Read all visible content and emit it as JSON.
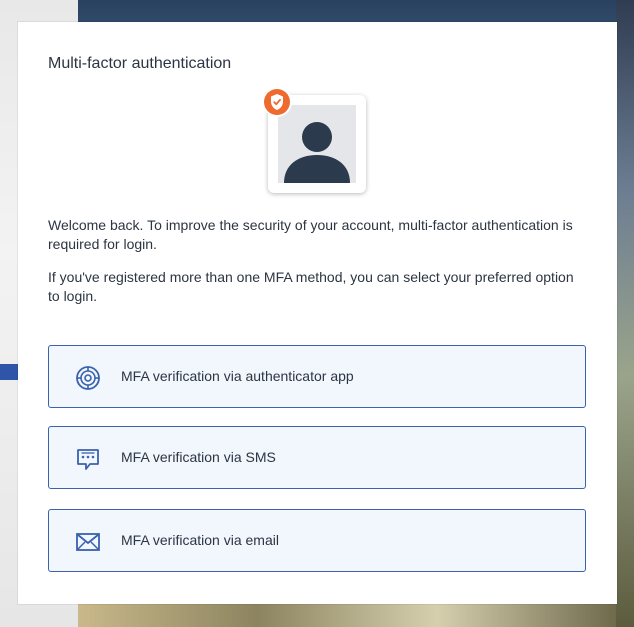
{
  "dialog": {
    "title": "Multi-factor authentication",
    "welcome_text": "Welcome back. To improve the security of your account, multi-factor authentication is required for login.",
    "info_text": "If you've registered more than one MFA method, you can select your preferred option to login."
  },
  "options": [
    {
      "label": "MFA verification via authenticator app",
      "icon": "authenticator-icon"
    },
    {
      "label": "MFA verification via SMS",
      "icon": "sms-icon"
    },
    {
      "label": "MFA verification via email",
      "icon": "email-icon"
    }
  ],
  "colors": {
    "accent_border": "#3a62ad",
    "option_background": "#f2f6fd",
    "badge_orange": "#ef6a2f",
    "text": "#2c3542",
    "avatar": "#2c3a4d"
  }
}
